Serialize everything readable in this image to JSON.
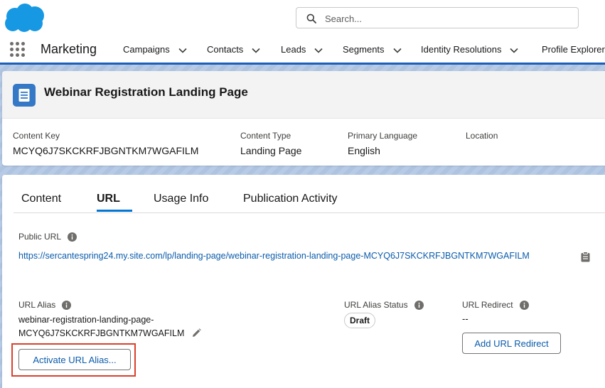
{
  "search": {
    "placeholder": "Search..."
  },
  "nav": {
    "app_name": "Marketing",
    "items": [
      {
        "label": "Campaigns"
      },
      {
        "label": "Contacts"
      },
      {
        "label": "Leads"
      },
      {
        "label": "Segments"
      },
      {
        "label": "Identity Resolutions"
      },
      {
        "label": "Profile Explorer"
      }
    ]
  },
  "record": {
    "icon": "document-icon",
    "title": "Webinar Registration Landing Page",
    "fields": [
      {
        "label": "Content Key",
        "value": "MCYQ6J7SKCKRFJBGNTKM7WGAFILM"
      },
      {
        "label": "Content Type",
        "value": "Landing Page"
      },
      {
        "label": "Primary Language",
        "value": "English"
      },
      {
        "label": "Location",
        "value": ""
      }
    ]
  },
  "tabs": [
    {
      "label": "Content"
    },
    {
      "label": "URL",
      "active": true
    },
    {
      "label": "Usage Info"
    },
    {
      "label": "Publication Activity"
    }
  ],
  "url_section": {
    "public_url_label": "Public URL",
    "public_url": "https://sercantespring24.my.site.com/lp/landing-page/webinar-registration-landing-page-MCYQ6J7SKCKRFJBGNTKM7WGAFILM",
    "alias_label": "URL Alias",
    "alias_line1": "webinar-registration-landing-page-",
    "alias_line2": "MCYQ6J7SKCKRFJBGNTKM7WGAFILM",
    "alias_status_label": "URL Alias Status",
    "alias_status": "Draft",
    "redirect_label": "URL Redirect",
    "redirect_value": "--",
    "activate_button": "Activate URL Alias...",
    "add_redirect_button": "Add URL Redirect"
  },
  "colors": {
    "brand": "#0176d3",
    "link": "#0b5cab",
    "highlight": "#d9402b",
    "nav_border": "#1b5fb8"
  }
}
